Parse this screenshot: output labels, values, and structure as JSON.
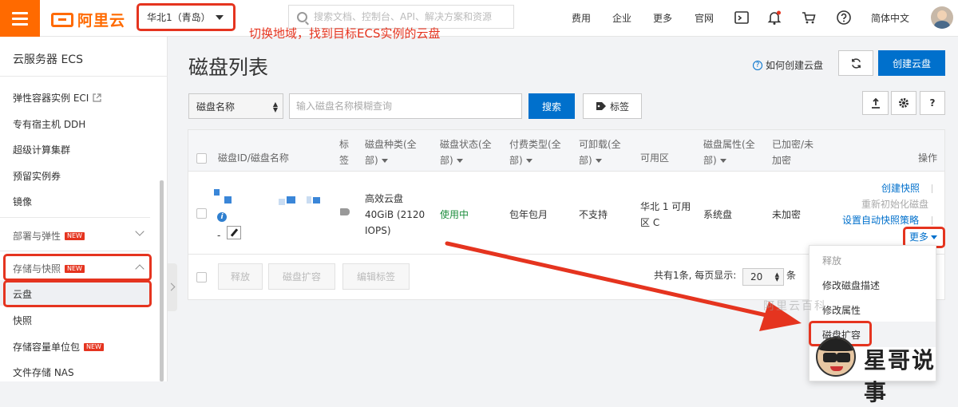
{
  "topbar": {
    "brand": "阿里云",
    "region": "华北1（青岛）",
    "search_placeholder": "搜索文档、控制台、API、解决方案和资源",
    "annotation": "切换地域，找到目标ECS实例的云盘",
    "nav": [
      "费用",
      "企业",
      "更多",
      "官网"
    ],
    "language": "简体中文"
  },
  "sidebar": {
    "title": "云服务器 ECS",
    "items": [
      {
        "label": "弹性容器实例 ECI",
        "external": true
      },
      {
        "label": "专有宿主机 DDH"
      },
      {
        "label": "超级计算集群"
      },
      {
        "label": "预留实例券"
      },
      {
        "label": "镜像"
      }
    ],
    "groups": [
      {
        "label": "部署与弹性",
        "badge": "NEW",
        "expanded": false
      },
      {
        "label": "存储与快照",
        "badge": "NEW",
        "expanded": true
      }
    ],
    "storage_items": [
      {
        "label": "云盘",
        "active": true
      },
      {
        "label": "快照"
      },
      {
        "label": "存储容量单位包",
        "badge": "NEW"
      },
      {
        "label": "文件存储 NAS"
      }
    ]
  },
  "page": {
    "title": "磁盘列表",
    "howto_link": "如何创建云盘",
    "create_button": "创建云盘",
    "filter_select": "磁盘名称",
    "filter_placeholder": "输入磁盘名称模糊查询",
    "search_button": "搜索",
    "tag_button": "标签"
  },
  "table": {
    "headers": {
      "disk_id": "磁盘ID/磁盘名称",
      "tag_1": "标",
      "tag_2": "签",
      "type_1": "磁盘种类(全",
      "type_2": "部)",
      "status_1": "磁盘状态(全",
      "status_2": "部)",
      "billing_1": "付费类型(全",
      "billing_2": "部)",
      "detach_1": "可卸载(全",
      "detach_2": "部)",
      "zone": "可用区",
      "attr_1": "磁盘属性(全",
      "attr_2": "部)",
      "enc_1": "已加密/未",
      "enc_2": "加密",
      "ops": "操作"
    },
    "row": {
      "name_placeholder": "-",
      "type_1": "高效云盘",
      "type_2": "40GiB (2120",
      "type_3": "IOPS)",
      "status": "使用中",
      "billing": "包年包月",
      "detachable": "不支持",
      "zone_1": "华北 1 可用",
      "zone_2": "区 C",
      "attribute": "系统盘",
      "encrypted": "未加密",
      "actions": {
        "snapshot": "创建快照",
        "reinit": "重新初始化磁盘",
        "auto_snapshot": "设置自动快照策略",
        "more": "更多"
      }
    },
    "footer": {
      "release": "释放",
      "expand": "磁盘扩容",
      "edit_tags": "编辑标签",
      "summary": "共有1条, 每页显示:",
      "page_size": "20",
      "unit": "条"
    }
  },
  "dropdown": {
    "items": [
      {
        "label": "释放",
        "disabled": true
      },
      {
        "label": "修改磁盘描述"
      },
      {
        "label": "修改属性"
      },
      {
        "label": "磁盘扩容",
        "highlighted": true
      }
    ]
  },
  "watermark": "阿里云百科",
  "overlay_brand": "星哥说事",
  "colors": {
    "accent": "#ff6a00",
    "primary": "#0070cc",
    "annotation": "#e5341f",
    "status_ok": "#1e8e3e"
  }
}
